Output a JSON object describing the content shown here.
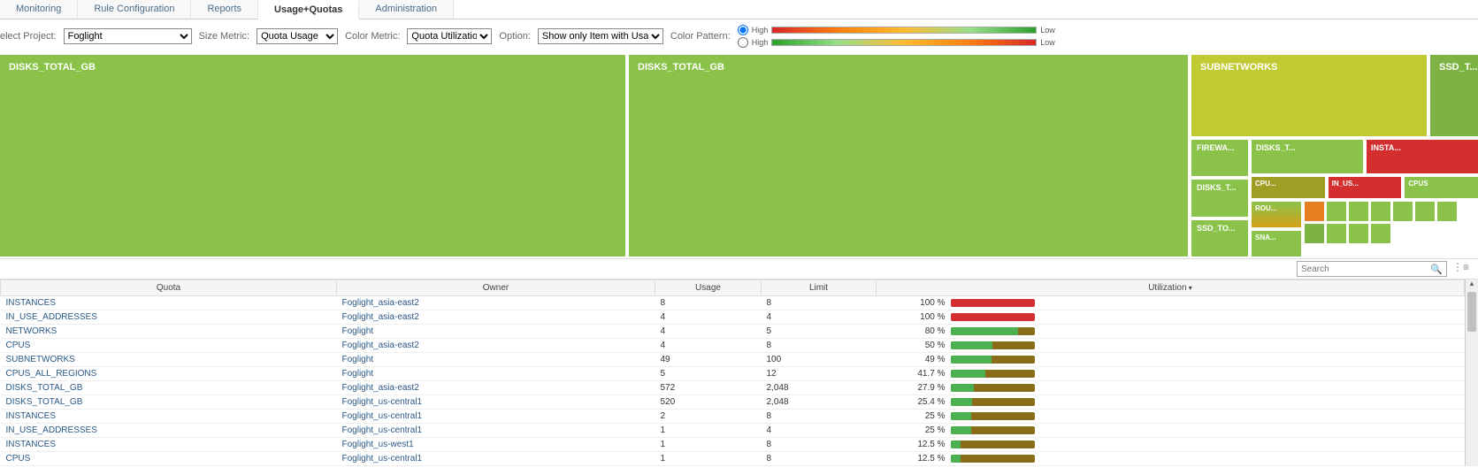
{
  "tabs": [
    {
      "label": "Monitoring",
      "active": false
    },
    {
      "label": "Rule Configuration",
      "active": false
    },
    {
      "label": "Reports",
      "active": false
    },
    {
      "label": "Usage+Quotas",
      "active": true
    },
    {
      "label": "Administration",
      "active": false
    }
  ],
  "filters": {
    "project_label": "elect Project:",
    "project_value": "Foglight",
    "size_label": "Size Metric:",
    "size_value": "Quota Usage",
    "color_label": "Color Metric:",
    "color_value": "Quota Utilization",
    "option_label": "Option:",
    "option_value": "Show only Item with Usage",
    "pattern_label": "Color Pattern:",
    "pattern_high": "High",
    "pattern_low": "Low",
    "pattern_selected": 0
  },
  "treemap": {
    "big_left": "DISKS_TOTAL_GB",
    "big_mid": "DISKS_TOTAL_GB",
    "subnetworks": "SUBNETWORKS",
    "ssd_t": "SSD_T...",
    "firewa": "FIREWA...",
    "disks_t1": "DISKS_T...",
    "insta": "INSTA...",
    "cpu": "CPU...",
    "in_us": "IN_US...",
    "cpus": "CPUS",
    "disks_t2": "DISKS_T...",
    "rou": "ROU...",
    "ssd_to": "SSD_TO...",
    "sna": "SNA..."
  },
  "search_placeholder": "Search",
  "columns": {
    "quota": "Quota",
    "owner": "Owner",
    "usage": "Usage",
    "limit": "Limit",
    "utilization": "Utilization"
  },
  "rows": [
    {
      "quota": "INSTANCES",
      "owner": "Foglight_asia-east2",
      "usage": "8",
      "limit": "8",
      "util": 100,
      "color": "#d32f2f"
    },
    {
      "quota": "IN_USE_ADDRESSES",
      "owner": "Foglight_asia-east2",
      "usage": "4",
      "limit": "4",
      "util": 100,
      "color": "#d32f2f"
    },
    {
      "quota": "NETWORKS",
      "owner": "Foglight",
      "usage": "4",
      "limit": "5",
      "util": 80,
      "color": "#4caf50"
    },
    {
      "quota": "CPUS",
      "owner": "Foglight_asia-east2",
      "usage": "4",
      "limit": "8",
      "util": 50,
      "color": "#4caf50"
    },
    {
      "quota": "SUBNETWORKS",
      "owner": "Foglight",
      "usage": "49",
      "limit": "100",
      "util": 49,
      "color": "#4caf50"
    },
    {
      "quota": "CPUS_ALL_REGIONS",
      "owner": "Foglight",
      "usage": "5",
      "limit": "12",
      "util": 41.7,
      "color": "#4caf50"
    },
    {
      "quota": "DISKS_TOTAL_GB",
      "owner": "Foglight_asia-east2",
      "usage": "572",
      "limit": "2,048",
      "util": 27.9,
      "color": "#4caf50"
    },
    {
      "quota": "DISKS_TOTAL_GB",
      "owner": "Foglight_us-central1",
      "usage": "520",
      "limit": "2,048",
      "util": 25.4,
      "color": "#4caf50"
    },
    {
      "quota": "INSTANCES",
      "owner": "Foglight_us-central1",
      "usage": "2",
      "limit": "8",
      "util": 25,
      "color": "#4caf50"
    },
    {
      "quota": "IN_USE_ADDRESSES",
      "owner": "Foglight_us-central1",
      "usage": "1",
      "limit": "4",
      "util": 25,
      "color": "#4caf50"
    },
    {
      "quota": "INSTANCES",
      "owner": "Foglight_us-west1",
      "usage": "1",
      "limit": "8",
      "util": 12.5,
      "color": "#4caf50"
    },
    {
      "quota": "CPUS",
      "owner": "Foglight_us-central1",
      "usage": "1",
      "limit": "8",
      "util": 12.5,
      "color": "#4caf50"
    }
  ]
}
